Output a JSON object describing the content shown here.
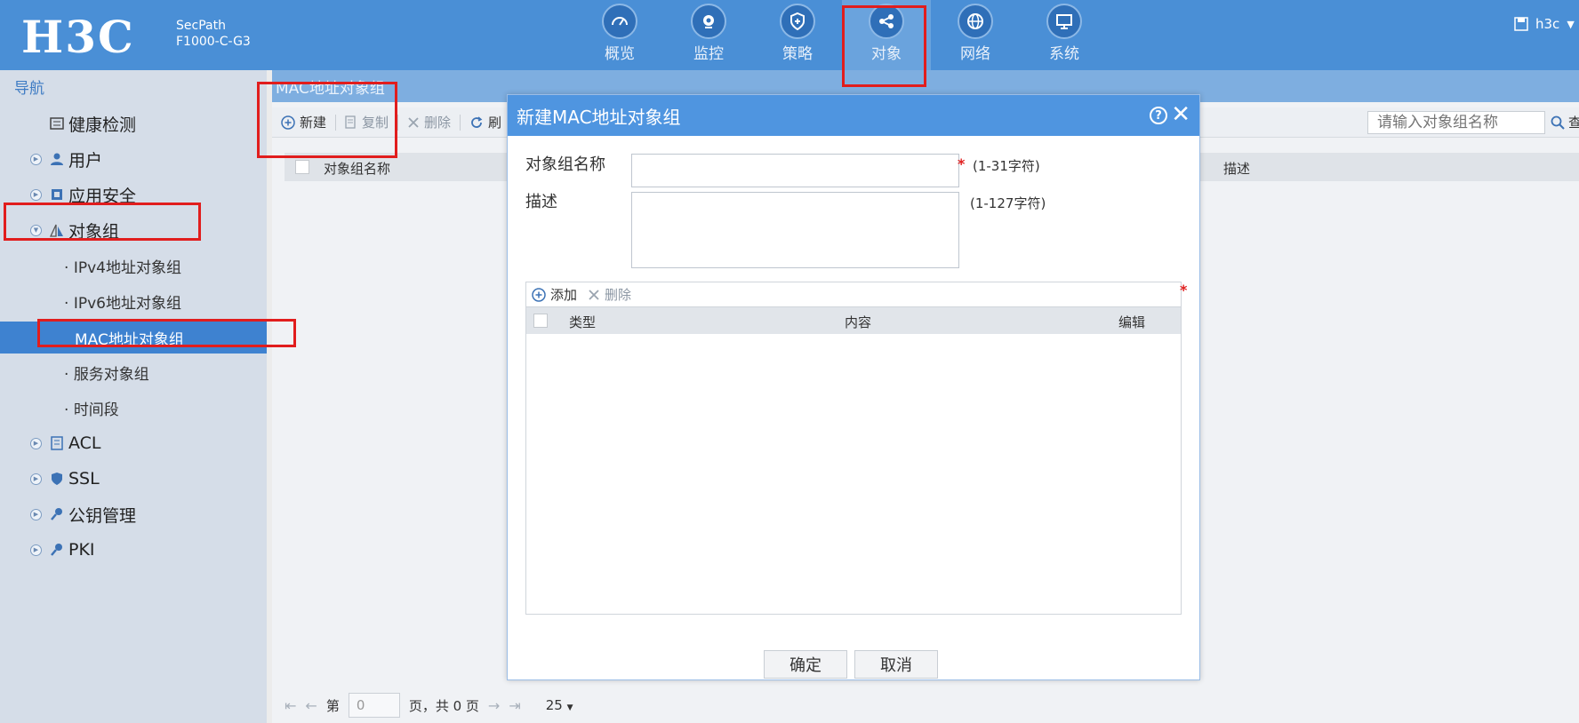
{
  "header": {
    "logo": "H3C",
    "product_line1": "SecPath",
    "product_line2": "F1000-C-G3",
    "nav": [
      {
        "label": "概览",
        "icon": "dashboard-icon"
      },
      {
        "label": "监控",
        "icon": "camera-icon"
      },
      {
        "label": "策略",
        "icon": "shield-icon"
      },
      {
        "label": "对象",
        "icon": "share-icon",
        "active": true
      },
      {
        "label": "网络",
        "icon": "globe-icon"
      },
      {
        "label": "系统",
        "icon": "monitor-icon"
      }
    ],
    "user": "h3c"
  },
  "sidebar": {
    "title": "导航",
    "items": [
      {
        "label": "健康检测",
        "icon": "health-check-icon"
      },
      {
        "label": "用户",
        "icon": "user-icon"
      },
      {
        "label": "应用安全",
        "icon": "app-security-icon"
      },
      {
        "label": "对象组",
        "icon": "object-group-icon"
      },
      {
        "label": "ACL",
        "icon": "acl-icon"
      },
      {
        "label": "SSL",
        "icon": "ssl-icon"
      },
      {
        "label": "公钥管理",
        "icon": "key-icon"
      },
      {
        "label": "PKI",
        "icon": "pki-icon"
      }
    ],
    "subitems": [
      {
        "label": "IPv4地址对象组"
      },
      {
        "label": "IPv6地址对象组"
      },
      {
        "label": "MAC地址对象组",
        "active": true
      },
      {
        "label": "服务对象组"
      },
      {
        "label": "时间段"
      }
    ]
  },
  "main": {
    "breadcrumb": "MAC地址对象组",
    "toolbar": {
      "new": "新建",
      "copy": "复制",
      "delete": "删除",
      "refresh": "刷"
    },
    "search": {
      "placeholder": "请输入对象组名称",
      "button": "查"
    },
    "table": {
      "col_name": "对象组名称",
      "col_desc": "描述"
    },
    "pager": {
      "page_prefix": "第",
      "page_value": "0",
      "page_suffix": "页，共 0 页",
      "page_size": "25"
    }
  },
  "dialog": {
    "title": "新建MAC地址对象组",
    "name_label": "对象组名称",
    "name_hint": "(1-31字符)",
    "desc_label": "描述",
    "desc_hint": "(1-127字符)",
    "required_mark": "*",
    "sub_toolbar": {
      "add": "添加",
      "delete": "删除"
    },
    "sub_table": {
      "col_type": "类型",
      "col_content": "内容",
      "col_edit": "编辑"
    },
    "ok": "确定",
    "cancel": "取消"
  },
  "colors": {
    "header_bg": "#4a8fd6",
    "active_nav": "#6aa3dd",
    "sidebar_active": "#3e82d0",
    "highlight_box": "#e11d1d"
  }
}
